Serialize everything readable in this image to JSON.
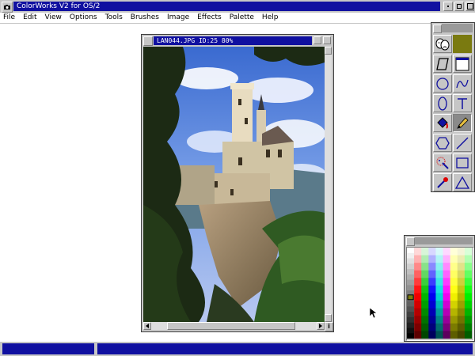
{
  "app": {
    "title": "ColorWorks V2 for OS/2"
  },
  "menubar": {
    "items": [
      {
        "id": "file",
        "label": "File"
      },
      {
        "id": "edit",
        "label": "Edit"
      },
      {
        "id": "view",
        "label": "View"
      },
      {
        "id": "options",
        "label": "Options"
      },
      {
        "id": "tools",
        "label": "Tools"
      },
      {
        "id": "brushes",
        "label": "Brushes"
      },
      {
        "id": "image",
        "label": "Image"
      },
      {
        "id": "effects",
        "label": "Effects"
      },
      {
        "id": "palette",
        "label": "Palette"
      },
      {
        "id": "help",
        "label": "Help"
      }
    ]
  },
  "image_window": {
    "title": "LAN044.JPG ID:25  80%",
    "zoom_percent": 80,
    "info_icon_label": "i"
  },
  "tool_palette": {
    "foreground_color": "#7a7a10",
    "background_color": "#ffffff",
    "active_tool": "pencil-tool",
    "tools": [
      "masks-tool",
      "color-swatch",
      "parallelogram-tool",
      "rectangle-fill-tool",
      "circle-tool",
      "curve-tool",
      "ellipse-tool",
      "text-tool",
      "fill-bucket-tool",
      "pencil-tool",
      "polygon-tool",
      "line-tool",
      "spray-tool",
      "rectangle-tool",
      "eyedropper-tool",
      "triangle-tool"
    ]
  },
  "color_palette": {
    "gray_column": [
      "#ffffff",
      "#f0f0f0",
      "#e0e0e0",
      "#d0d0d0",
      "#c0c0c0",
      "#b0b0b0",
      "#a0a0a0",
      "#909090",
      "#808080",
      "#707070",
      "#606060",
      "#505050",
      "#404040",
      "#303030",
      "#202020",
      "#101010",
      "#000000"
    ],
    "columns": [
      "#ff0000",
      "#00c000",
      "#0000ff",
      "#00e0e0",
      "#ff00ff",
      "#ffff00",
      "#c0c000",
      "#00ff00"
    ],
    "selected_color": "#7a7a10"
  },
  "colors": {
    "titlebar_active": "#1010a0",
    "chrome": "#c6c6c6"
  }
}
